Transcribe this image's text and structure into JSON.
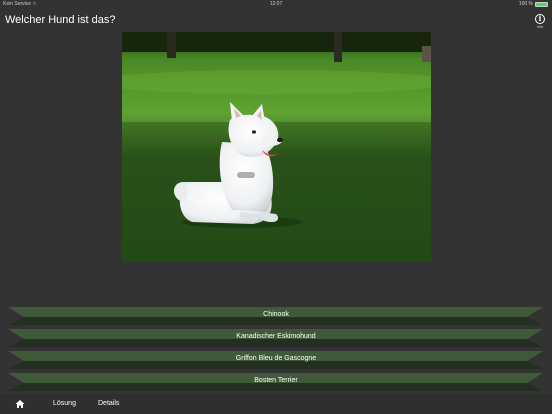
{
  "status_bar": {
    "carrier": "Kein Service",
    "time": "12:07",
    "battery_percent": "100 %",
    "battery_level": 1.0,
    "battery_color": "#4cd964"
  },
  "header": {
    "title": "Welcher Hund ist das?",
    "info_icon": "info-icon",
    "info_label": "Info"
  },
  "photo": {
    "subject": "white dog sitting on grass"
  },
  "answers": [
    {
      "label": "Chinook"
    },
    {
      "label": "Kanadischer Eskimohund"
    },
    {
      "label": "Griffon Bleu de Gascogne"
    },
    {
      "label": "Bosten Terrier"
    }
  ],
  "answer_colors": {
    "face": "#3f5a38",
    "shadow": "#252e22"
  },
  "tab_bar": {
    "home_icon": "home-icon",
    "solution_label": "Lösung",
    "details_label": "Details"
  }
}
